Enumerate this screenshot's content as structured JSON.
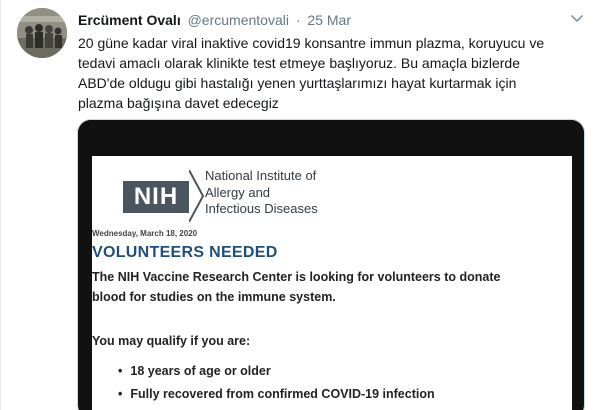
{
  "tweet": {
    "author_name": "Ercüment Ovalı",
    "handle": "@ercumentovali",
    "separator": "·",
    "time": "25 Mar",
    "text_lines": [
      "20 güne kadar viral inaktive covid19 konsantre immun plazma, koruyucu ve",
      "tedavi amaclı olarak klinikte test etmeye başlıyoruz. Bu amaçla bizlerde",
      "ABD'de oldugu gibi hastalığı yenen yurttaşlarımızı hayat kurtarmak için",
      "plazma bağışına davet edecegiz"
    ]
  },
  "media": {
    "logo_text": "NIH",
    "institute_lines": [
      "National Institute of",
      "Allergy and",
      "Infectious Diseases"
    ],
    "date": "Wednesday, March 18, 2020",
    "headline": "VOLUNTEERS NEEDED",
    "lede_lines": [
      "The NIH Vaccine Research Center is looking for volunteers to donate",
      "blood for studies on the immune system."
    ],
    "qualify_heading": "You may qualify if you are:",
    "bullets": [
      "18 years of age or older",
      "Fully recovered from confirmed COVID-19 infection"
    ]
  },
  "icons": {
    "caret": "chevron-down-icon",
    "avatar": "user-avatar"
  },
  "colors": {
    "secondary_text": "#657786",
    "headline_blue": "#1f4f7a",
    "nih_gray": "#4a5560"
  }
}
